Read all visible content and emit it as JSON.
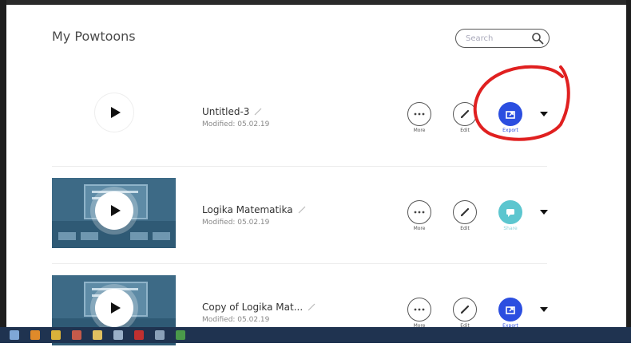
{
  "page": {
    "title": "My Powtoons"
  },
  "search": {
    "placeholder": "Search"
  },
  "powtoons": [
    {
      "name": "Untitled-3",
      "modified": "Modified: 05.02.19",
      "thumbnail": "blank",
      "actions": {
        "more": "More",
        "edit": "Edit",
        "third": "Export",
        "third_type": "export"
      }
    },
    {
      "name": "Logika Matematika",
      "modified": "Modified: 05.02.19",
      "thumbnail": "classroom",
      "actions": {
        "more": "More",
        "edit": "Edit",
        "third": "Share",
        "third_type": "share"
      }
    },
    {
      "name": "Copy of Logika Mat...",
      "modified": "Modified: 05.02.19",
      "thumbnail": "classroom",
      "actions": {
        "more": "More",
        "edit": "Edit",
        "third": "Export",
        "third_type": "export"
      }
    }
  ],
  "colors": {
    "export": "#2b4ee0",
    "share": "#5cc6cf",
    "annotation": "#e02020",
    "taskbar": "#1f3350"
  },
  "icons": [
    "search-icon",
    "play-icon",
    "pencil-icon",
    "ellipsis-icon",
    "export-icon",
    "share-icon",
    "caret-down-icon"
  ]
}
